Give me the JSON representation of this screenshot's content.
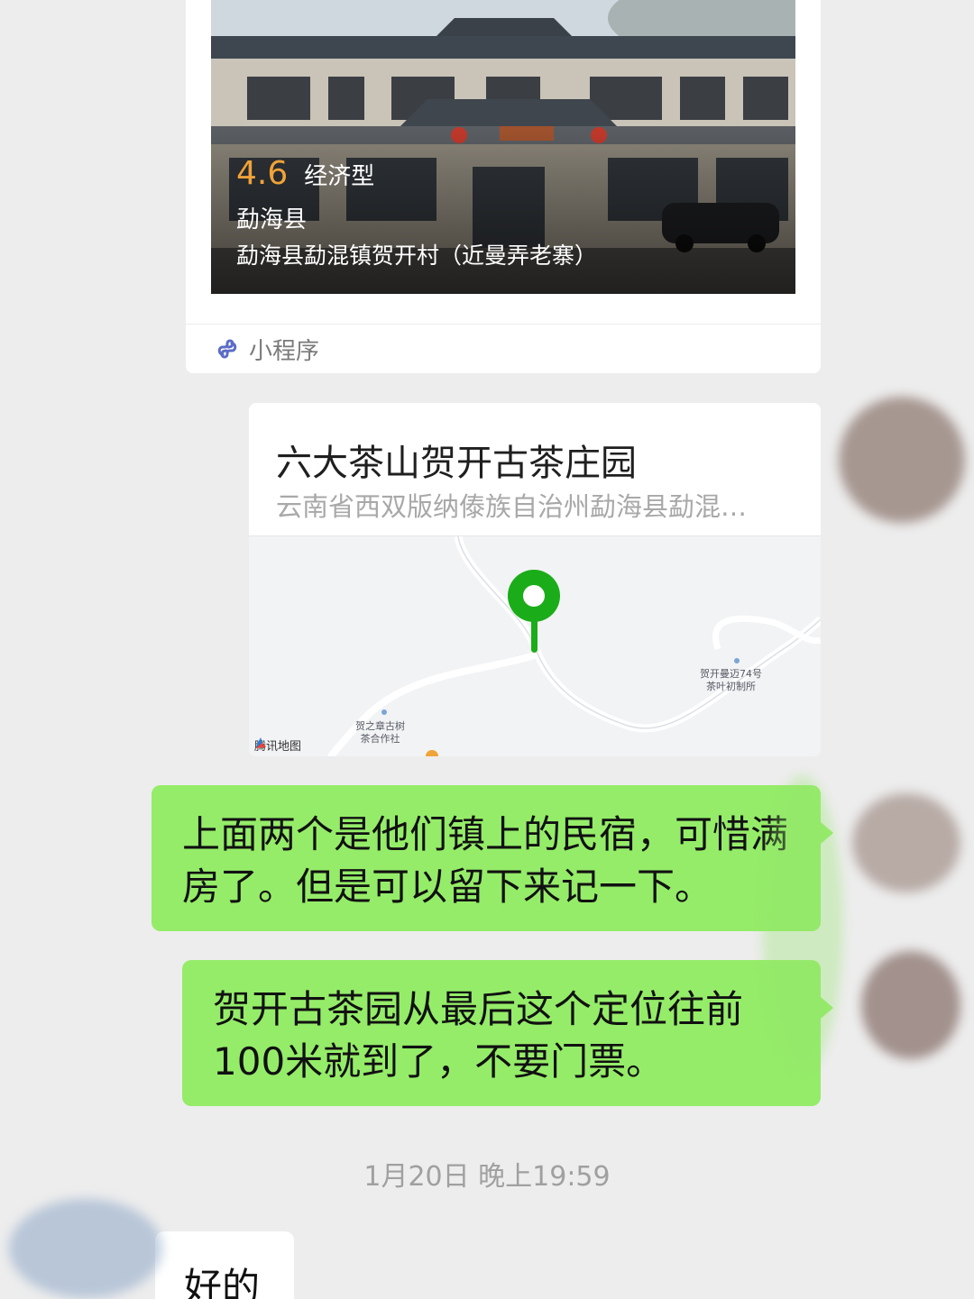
{
  "mini_program_card": {
    "rating": "4.6",
    "type": "经济型",
    "county": "勐海县",
    "address": "勐海县勐混镇贺开村（近曼弄老寨）",
    "footer_label": "小程序",
    "footer_icon": "mini-program-icon"
  },
  "location_card": {
    "title": "六大茶山贺开古茶庄园",
    "address": "云南省西双版纳傣族自治州勐海县勐混…",
    "map": {
      "pin_icon": "location-pin-icon",
      "pin_color": "#1aad19",
      "poi_1": [
        "贺开曼迈74号",
        "茶叶初制所"
      ],
      "poi_2": [
        "贺之章古树",
        "茶合作社"
      ],
      "provider": "腾讯地图"
    }
  },
  "messages": [
    {
      "side": "right",
      "text": "上面两个是他们镇上的民宿，可惜满房了。但是可以留下来记一下。"
    },
    {
      "side": "right",
      "text": "贺开古茶园从最后这个定位往前100米就到了，不要门票。"
    }
  ],
  "timestamp": "1月20日 晚上19:59",
  "incoming": {
    "side": "left",
    "text": "好的"
  },
  "colors": {
    "background": "#ededed",
    "outgoing_bubble": "#95ec69",
    "incoming_bubble": "#ffffff",
    "rating": "#f0a338"
  }
}
